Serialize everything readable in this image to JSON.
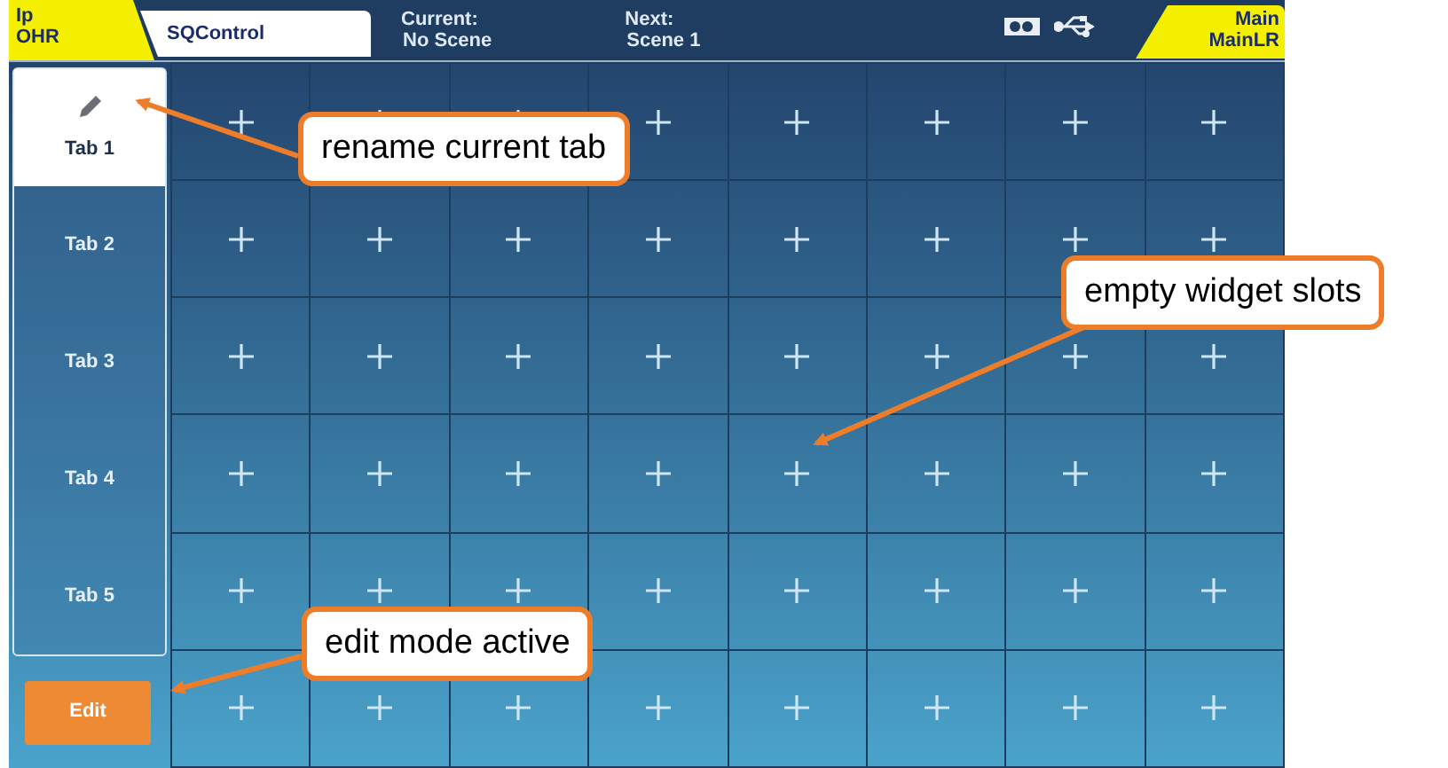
{
  "header": {
    "left_badge": [
      "Ip",
      "OHR"
    ],
    "app_name": "SQControl",
    "current": {
      "label": "Current:",
      "value": "No Scene"
    },
    "next": {
      "label": "Next:",
      "value": "Scene 1"
    },
    "right_badge": [
      "Main",
      "MainLR"
    ]
  },
  "tabs": [
    {
      "label": "Tab 1",
      "selected": true
    },
    {
      "label": "Tab 2",
      "selected": false
    },
    {
      "label": "Tab 3",
      "selected": false
    },
    {
      "label": "Tab 4",
      "selected": false
    },
    {
      "label": "Tab 5",
      "selected": false
    }
  ],
  "edit_button": {
    "label": "Edit",
    "active": true
  },
  "slots": [
    [
      {
        "empty": true
      },
      {
        "empty": true
      },
      {
        "empty": true
      },
      {
        "empty": true
      },
      {
        "empty": true
      },
      {
        "empty": true
      },
      {
        "empty": true
      },
      {
        "empty": true
      }
    ],
    [
      {
        "empty": true
      },
      {
        "empty": true
      },
      {
        "empty": true
      },
      {
        "empty": true
      },
      {
        "empty": true
      },
      {
        "empty": true
      },
      {
        "empty": true
      },
      {
        "empty": true
      }
    ],
    [
      {
        "empty": true
      },
      {
        "empty": true
      },
      {
        "empty": true
      },
      {
        "empty": true
      },
      {
        "empty": true
      },
      {
        "empty": true
      },
      {
        "empty": true
      },
      {
        "empty": true
      }
    ],
    [
      {
        "empty": true
      },
      {
        "empty": true
      },
      {
        "empty": true
      },
      {
        "empty": true
      },
      {
        "empty": true
      },
      {
        "empty": true
      },
      {
        "empty": true
      },
      {
        "empty": true
      }
    ],
    [
      {
        "empty": true
      },
      {
        "empty": true
      },
      {
        "empty": true
      },
      {
        "empty": true
      },
      {
        "empty": true
      },
      {
        "empty": true
      },
      {
        "empty": true
      },
      {
        "empty": true
      }
    ],
    [
      {
        "empty": true
      },
      {
        "empty": true
      },
      {
        "empty": true
      },
      {
        "empty": true
      },
      {
        "empty": true
      },
      {
        "empty": true
      },
      {
        "empty": true
      },
      {
        "empty": true
      }
    ]
  ],
  "callouts": [
    {
      "text": "rename current tab"
    },
    {
      "text": "empty widget slots"
    },
    {
      "text": "edit mode active"
    }
  ]
}
